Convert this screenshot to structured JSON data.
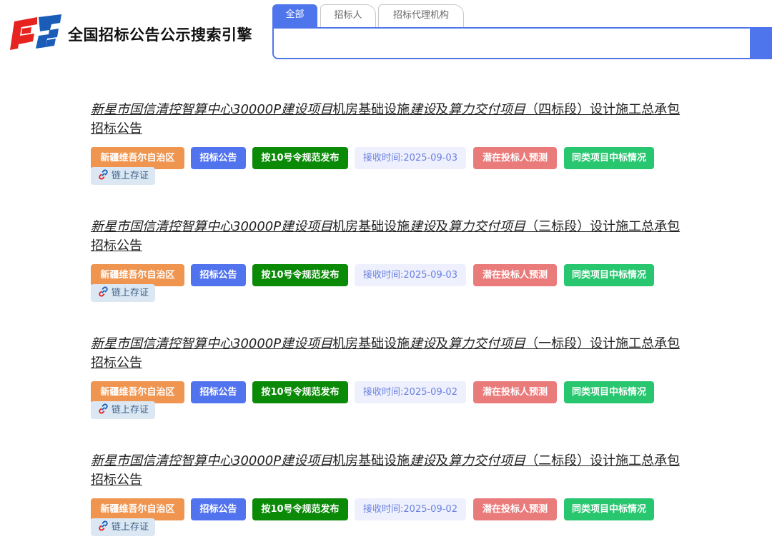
{
  "header": {
    "site_title": "全国招标公告公示搜索引擎",
    "logo_icon": "cebpub-logo-icon",
    "tabs": [
      {
        "label": "全部",
        "active": true
      },
      {
        "label": "招标人",
        "active": false
      },
      {
        "label": "招标代理机构",
        "active": false
      }
    ],
    "search": {
      "value": "",
      "placeholder": ""
    },
    "colors": {
      "accent": "#4f75ec"
    }
  },
  "results": [
    {
      "title_parts": [
        "新星市国信清控智算中心30000P建设项目",
        "机房基础设施",
        "建设",
        "及",
        "算力交付项目",
        "（四标段）设计施工总承包招标公告"
      ],
      "tags": {
        "region": "新疆维吾尔自治区",
        "type": "招标公告",
        "rule": "按10号令规范发布",
        "date": "接收时间:2025-09-03",
        "predict": "潜在投标人预测",
        "similar": "同类项目中标情况",
        "chain": "链上存证"
      }
    },
    {
      "title_parts": [
        "新星市国信清控智算中心30000P建设项目",
        "机房基础设施",
        "建设",
        "及",
        "算力交付项目",
        "（三标段）设计施工总承包招标公告"
      ],
      "tags": {
        "region": "新疆维吾尔自治区",
        "type": "招标公告",
        "rule": "按10号令规范发布",
        "date": "接收时间:2025-09-03",
        "predict": "潜在投标人预测",
        "similar": "同类项目中标情况",
        "chain": "链上存证"
      }
    },
    {
      "title_parts": [
        "新星市国信清控智算中心30000P建设项目",
        "机房基础设施",
        "建设",
        "及",
        "算力交付项目",
        "（一标段）设计施工总承包招标公告"
      ],
      "tags": {
        "region": "新疆维吾尔自治区",
        "type": "招标公告",
        "rule": "按10号令规范发布",
        "date": "接收时间:2025-09-02",
        "predict": "潜在投标人预测",
        "similar": "同类项目中标情况",
        "chain": "链上存证"
      }
    },
    {
      "title_parts": [
        "新星市国信清控智算中心30000P建设项目",
        "机房基础设施",
        "建设",
        "及",
        "算力交付项目",
        "（二标段）设计施工总承包招标公告"
      ],
      "tags": {
        "region": "新疆维吾尔自治区",
        "type": "招标公告",
        "rule": "按10号令规范发布",
        "date": "接收时间:2025-09-02",
        "predict": "潜在投标人预测",
        "similar": "同类项目中标情况",
        "chain": "链上存证"
      }
    }
  ],
  "tag_colors": {
    "region": "#f0954f",
    "type": "#5273ee",
    "rule": "#0b8a08",
    "date_bg": "#eef1fd",
    "predict": "#ea7b7b",
    "similar": "#28c66f",
    "chain_bg": "#dbe8f3"
  }
}
